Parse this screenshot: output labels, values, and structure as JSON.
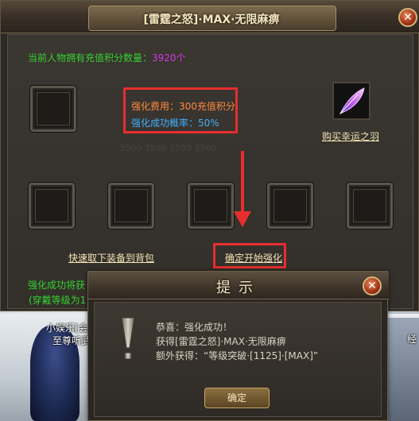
{
  "background": {
    "player_name_line1": "小娱乐[会",
    "player_name_line2": "至尊听武",
    "right_fragment": "经"
  },
  "window": {
    "title": "[雷霆之怒]·MAX·无限麻痹",
    "close_icon": "close-x-icon",
    "points_label": "当前人物拥有充值积分数量：",
    "points_value": "3920个",
    "cost": "强化费用：300充值积分",
    "rate": "强化成功概率：50%",
    "buy_link": "购买幸运之羽",
    "feather_icon": "lucky-feather-icon",
    "quick_unequip": "快速取下装备到背包",
    "start_enhance": "确定开始强化",
    "success_note": "强化成功将获",
    "level_note": "(穿戴等级为1",
    "highlight_color": "#e62e2e"
  },
  "dialog": {
    "title": "提示",
    "message_line1": "恭喜：强化成功！",
    "message_line2": "获得[雷霆之怒]·MAX·无限麻痹",
    "message_line3": "额外获得：“等级突破·[1125]·[MAX]”",
    "ok_label": "确定",
    "warning_icon": "exclamation-icon"
  }
}
